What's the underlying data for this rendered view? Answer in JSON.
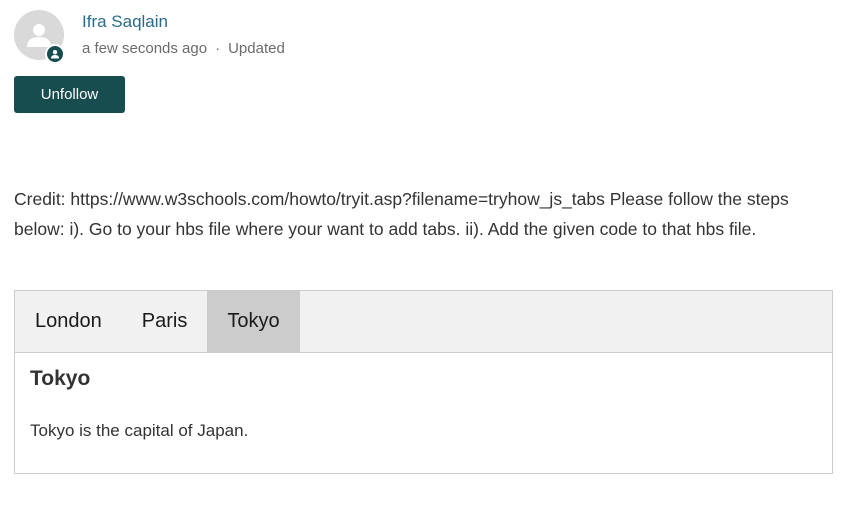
{
  "author": {
    "name": "Ifra Saqlain",
    "time": "a few seconds ago",
    "separator": "·",
    "status": "Updated"
  },
  "follow_button": {
    "label": "Unfollow"
  },
  "post": {
    "body": "Credit: https://www.w3schools.com/howto/tryit.asp?filename=tryhow_js_tabs Please follow the steps below: i). Go to your hbs file where your want to add tabs. ii). Add the given code to that hbs file."
  },
  "tabs": {
    "items": [
      {
        "label": "London"
      },
      {
        "label": "Paris"
      },
      {
        "label": "Tokyo",
        "active": true
      }
    ],
    "content": {
      "heading": "Tokyo",
      "text": "Tokyo is the capital of Japan."
    }
  },
  "colors": {
    "brand": "#174d4f",
    "link": "#2a6a8b",
    "active_tab": "#cccccc",
    "tab_bar": "#f1f1f1"
  },
  "icons": {
    "avatar": "user-silhouette-icon",
    "badge": "user-badge-icon"
  }
}
